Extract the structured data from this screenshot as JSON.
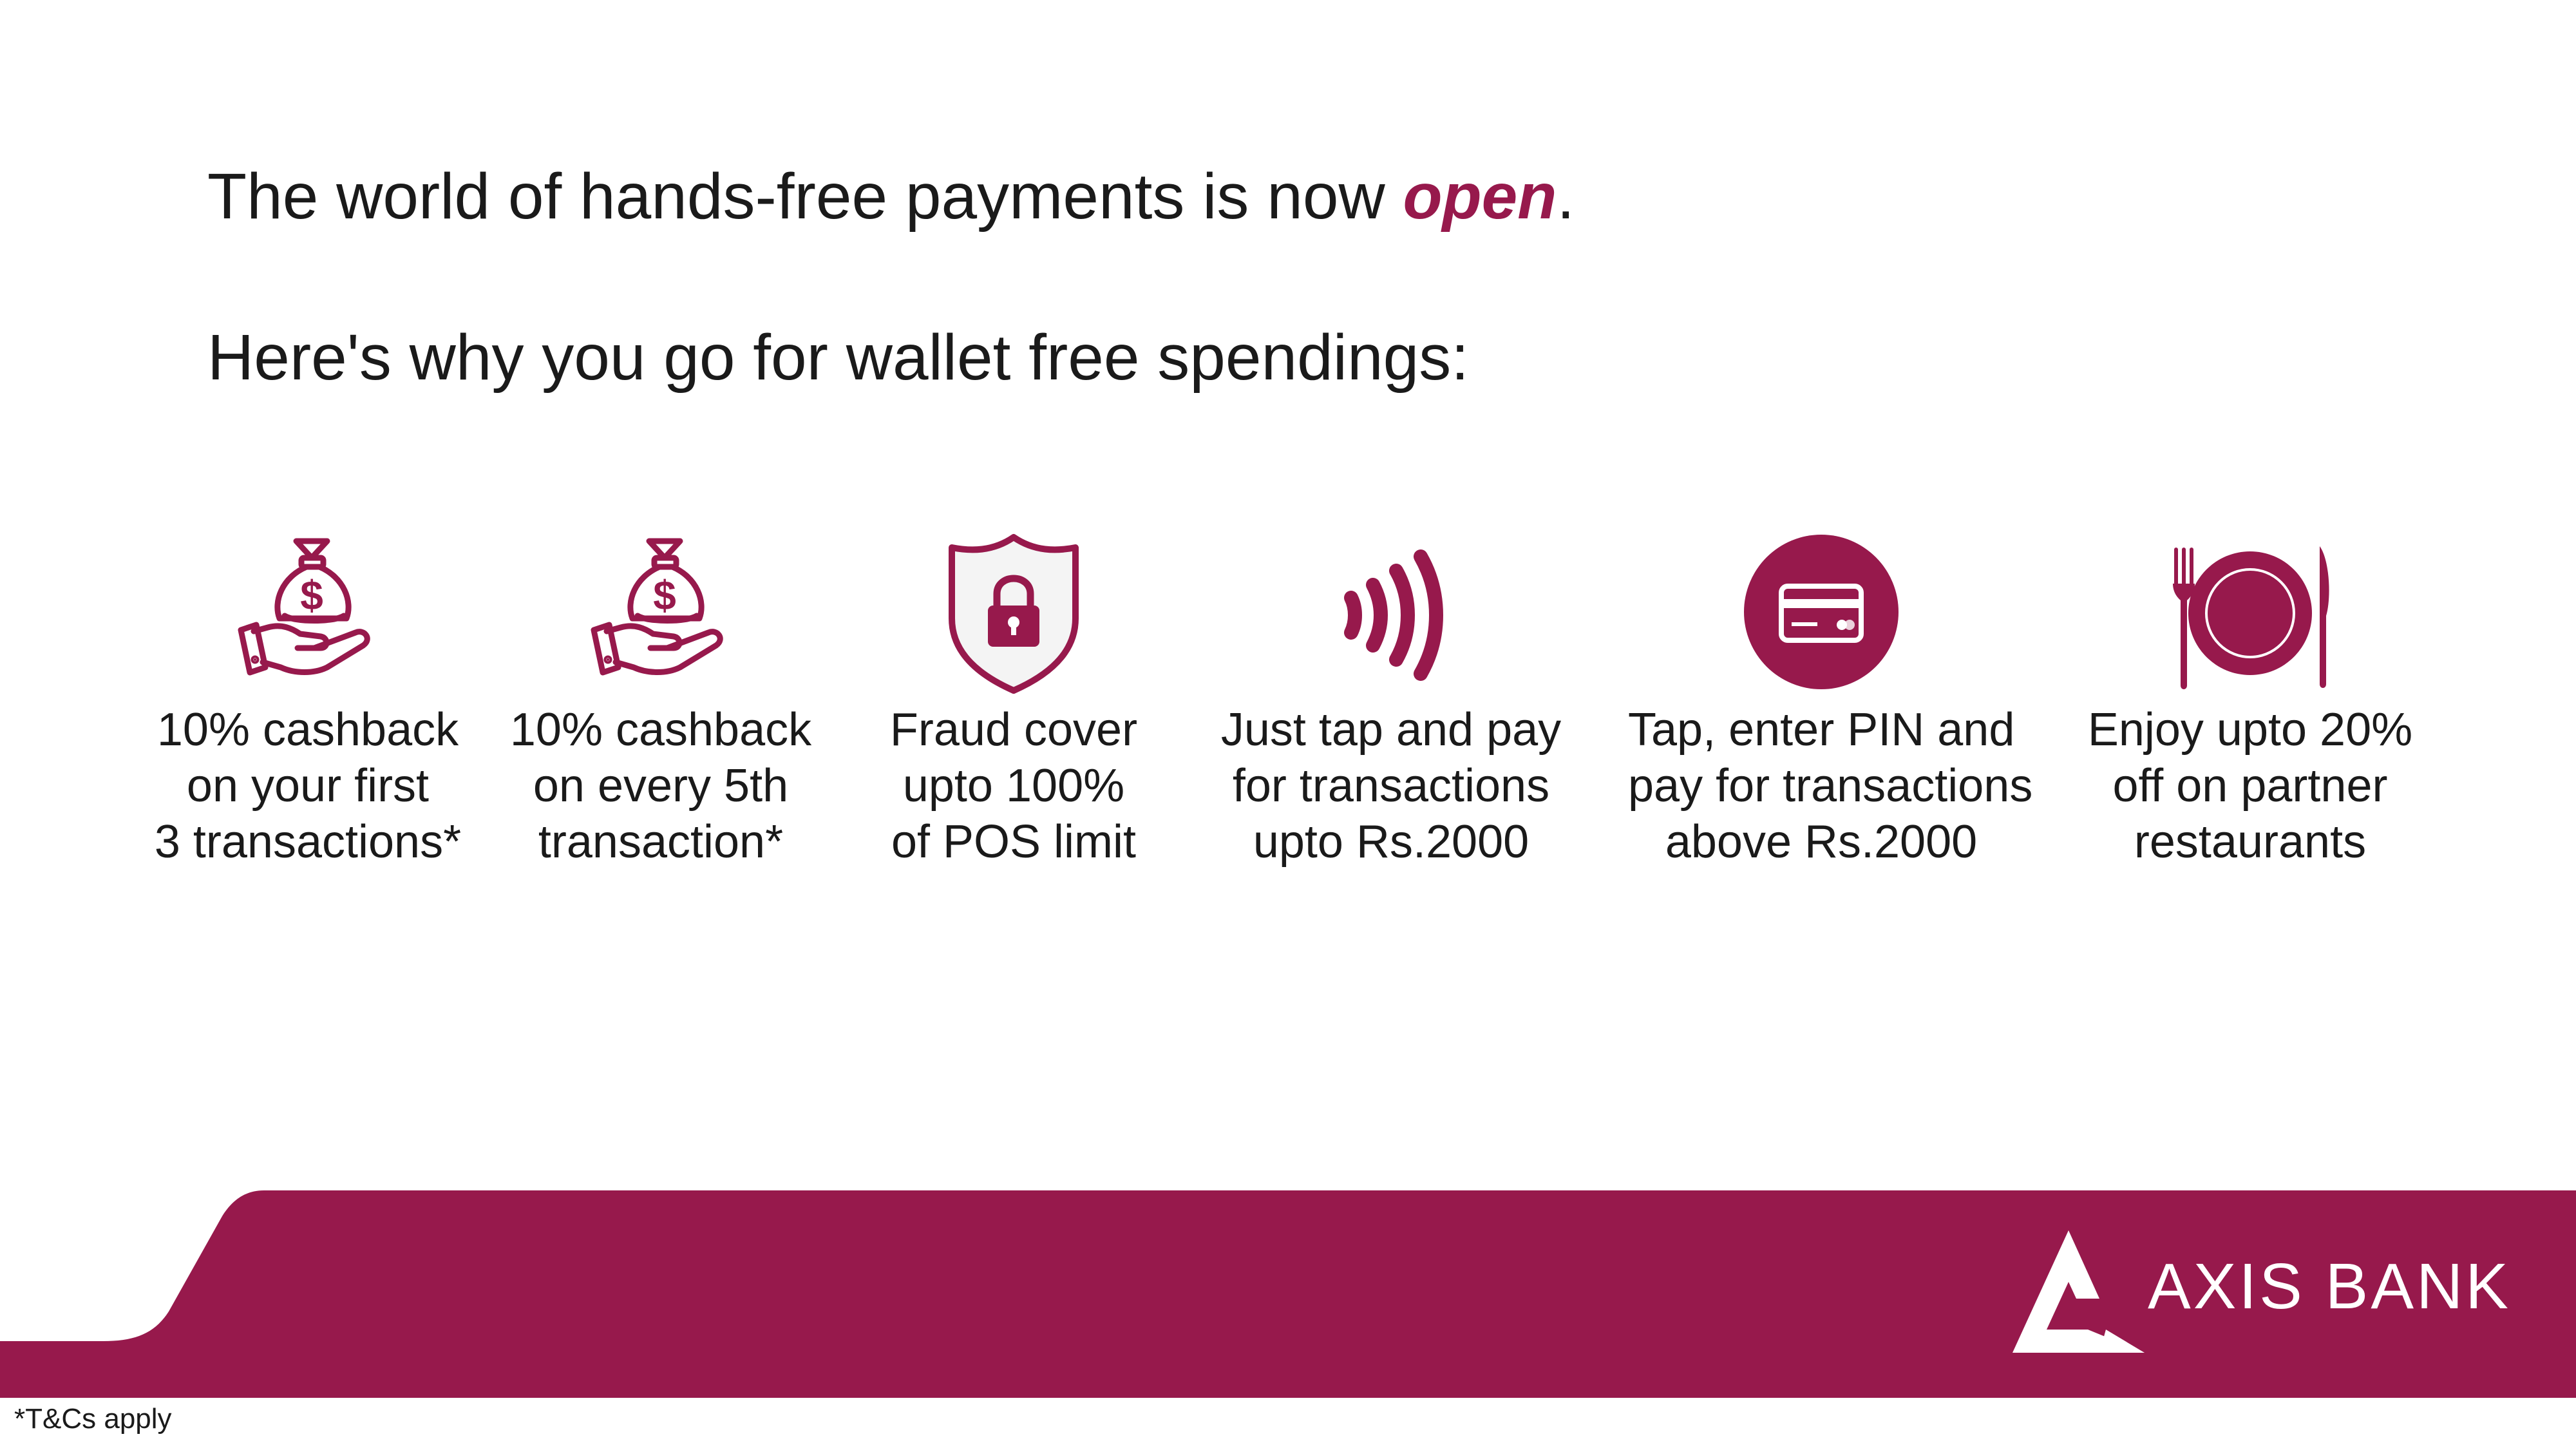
{
  "headline": {
    "prefix": "The world of hands-free payments is now ",
    "accent": "open",
    "suffix": "."
  },
  "subhead": "Here's why you go for wallet free spendings:",
  "colors": {
    "brand": "#97194c",
    "text": "#1a1a1a",
    "background": "#ffffff"
  },
  "features": [
    {
      "icon": "money-bag-hand-icon",
      "lines": [
        "10% cashback",
        "on your first",
        "3 transactions*"
      ]
    },
    {
      "icon": "money-bag-hand-icon",
      "lines": [
        "10% cashback",
        "on every 5th",
        "transaction*"
      ]
    },
    {
      "icon": "shield-lock-icon",
      "lines": [
        "Fraud cover",
        "upto 100%",
        "of POS limit"
      ]
    },
    {
      "icon": "contactless-wave-icon",
      "lines": [
        "Just tap and pay",
        "for transactions",
        "upto Rs.2000"
      ]
    },
    {
      "icon": "card-circle-icon",
      "lines": [
        "Tap, enter PIN and",
        "pay for transactions",
        "above Rs.2000"
      ]
    },
    {
      "icon": "plate-cutlery-icon",
      "lines": [
        "Enjoy upto 20%",
        "off on partner",
        "restaurants"
      ]
    }
  ],
  "footer": {
    "logo_text": "AXIS BANK",
    "logo_icon": "axis-bank-logo-icon"
  },
  "tnc": "*T&Cs apply"
}
